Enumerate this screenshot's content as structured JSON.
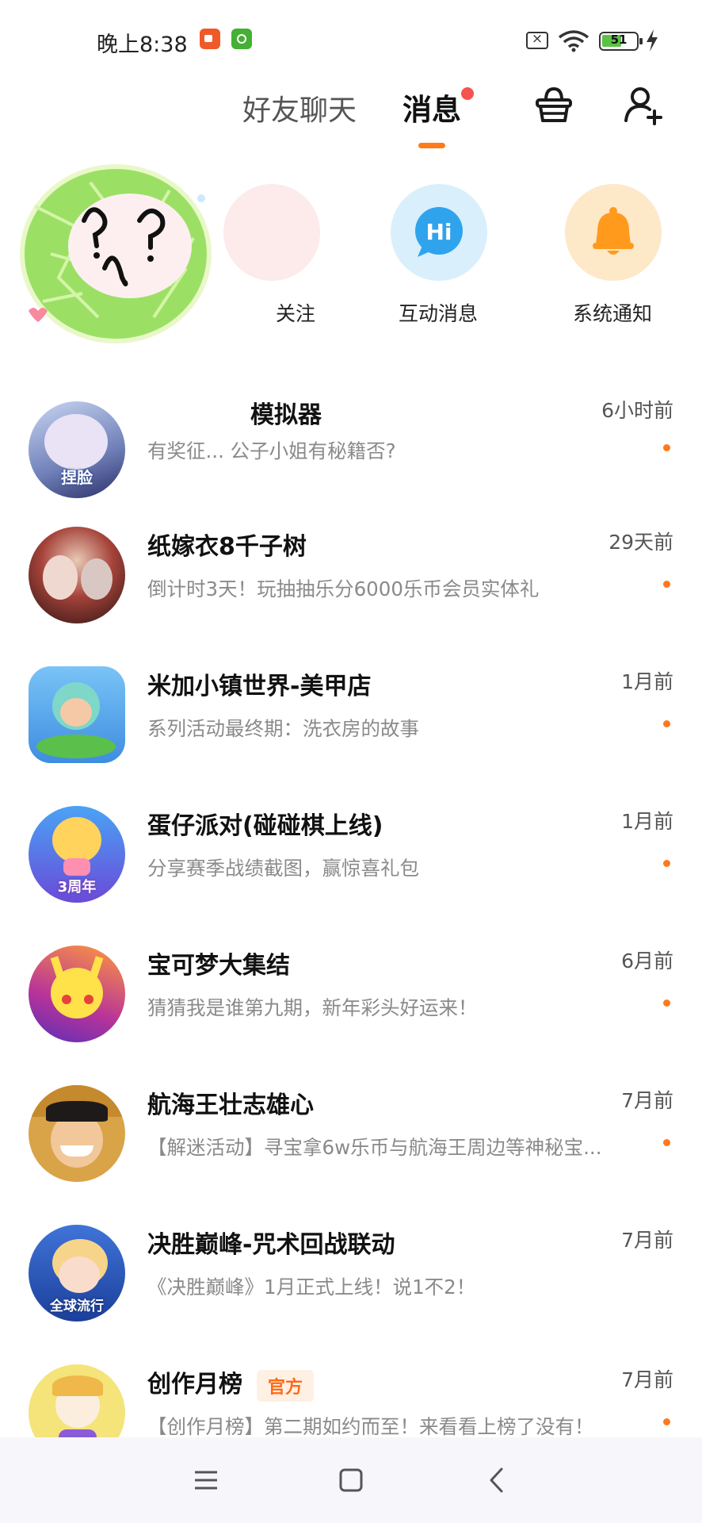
{
  "status_bar": {
    "time": "晚上8:38",
    "battery": "51"
  },
  "header": {
    "tabs": [
      {
        "label": "好友聊天",
        "active": false
      },
      {
        "label": "消息",
        "active": true
      }
    ],
    "icons": [
      "basket-icon",
      "add-friend-icon"
    ]
  },
  "quick_entries": [
    {
      "label": "关注",
      "visible_label": "关注"
    },
    {
      "label": "互动消息",
      "icon": "hi-chat-icon"
    },
    {
      "label": "系统通知",
      "icon": "bell-icon"
    }
  ],
  "messages": [
    {
      "name": "模拟器",
      "preview": "有奖征... 公子小姐有秘籍否?",
      "time": "6小时前"
    },
    {
      "name": "纸嫁衣8千子树",
      "preview": "倒计时3天！玩抽抽乐分6000乐币会员实体礼",
      "time": "29天前"
    },
    {
      "name": "米加小镇世界-美甲店",
      "preview": "系列活动最终期：洗衣房的故事",
      "time": "1月前"
    },
    {
      "name": "蛋仔派对(碰碰棋上线)",
      "preview": "分享赛季战绩截图，赢惊喜礼包",
      "time": "1月前"
    },
    {
      "name": "宝可梦大集结",
      "preview": "猜猜我是谁第九期，新年彩头好运来！",
      "time": "6月前"
    },
    {
      "name": "航海王壮志雄心",
      "preview": "【解迷活动】寻宝拿6w乐币与航海王周边等神秘宝...",
      "time": "7月前"
    },
    {
      "name": "决胜巅峰-咒术回战联动",
      "preview": "《决胜巅峰》1月正式上线！说1不2！",
      "time": "7月前"
    },
    {
      "name": "创作月榜",
      "badge": "官方",
      "preview": "【创作月榜】第二期如约而至！来看看上榜了没有！",
      "time": "7月前"
    }
  ],
  "avatar_text": {
    "item0": "捏脸",
    "item3": "3周年",
    "item6": "全球流行"
  },
  "colors": {
    "accent": "#ff7a1a",
    "dot": "#f4544f",
    "hi_bg": "#d9effc",
    "hi_fg": "#2fa4ec",
    "bell_bg": "#fde8c8",
    "bell_fg": "#ff9a1c"
  }
}
